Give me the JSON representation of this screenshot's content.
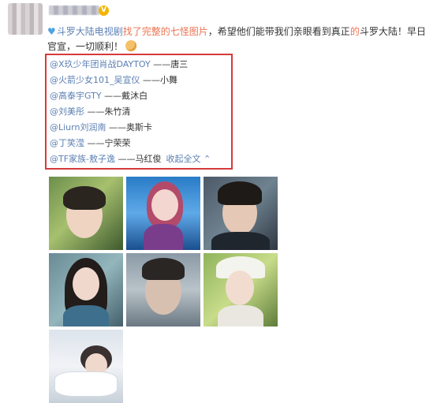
{
  "post": {
    "verified_icon": "verified-badge-icon",
    "topic_icon": "topic-icon",
    "topic": "斗罗大陆电视剧",
    "highlight_1": "找了完整的七怪图片",
    "text_1": "，希望他们能带我们亲眼看到真正",
    "highlight_2": "的",
    "text_2": "斗罗大陆",
    "text_3": "！早日官宣，一切顺利！",
    "emoji_icon": "fist-emoji-icon"
  },
  "cast": [
    {
      "mention": "@X玖少年团肖战DAYTOY",
      "role": "——唐三"
    },
    {
      "mention": "@火箭少女101_吴宣仪",
      "role": "——小舞"
    },
    {
      "mention": "@高泰宇GTY",
      "role": "——戴沐白"
    },
    {
      "mention": "@刘美彤",
      "role": "——朱竹清"
    },
    {
      "mention": "@Liurn刘润南",
      "role": "——奥斯卡"
    },
    {
      "mention": "@丁笑滢",
      "role": "——宁荣荣"
    },
    {
      "mention": "@TF家族-敖子逸",
      "role": "——马红俊"
    }
  ],
  "expand_label": "收起全文 ⌃",
  "photos": [
    {
      "name": "photo-xiao-zhan"
    },
    {
      "name": "photo-wu-xuanyi"
    },
    {
      "name": "photo-gao-taiyu"
    },
    {
      "name": "photo-liu-meitong"
    },
    {
      "name": "photo-liu-runnan"
    },
    {
      "name": "photo-ding-xiaoying"
    },
    {
      "name": "photo-ao-ziyi"
    }
  ],
  "colors": {
    "link": "#5b7fb3",
    "highlight": "#eb7350",
    "box_border": "#d63a3a"
  }
}
